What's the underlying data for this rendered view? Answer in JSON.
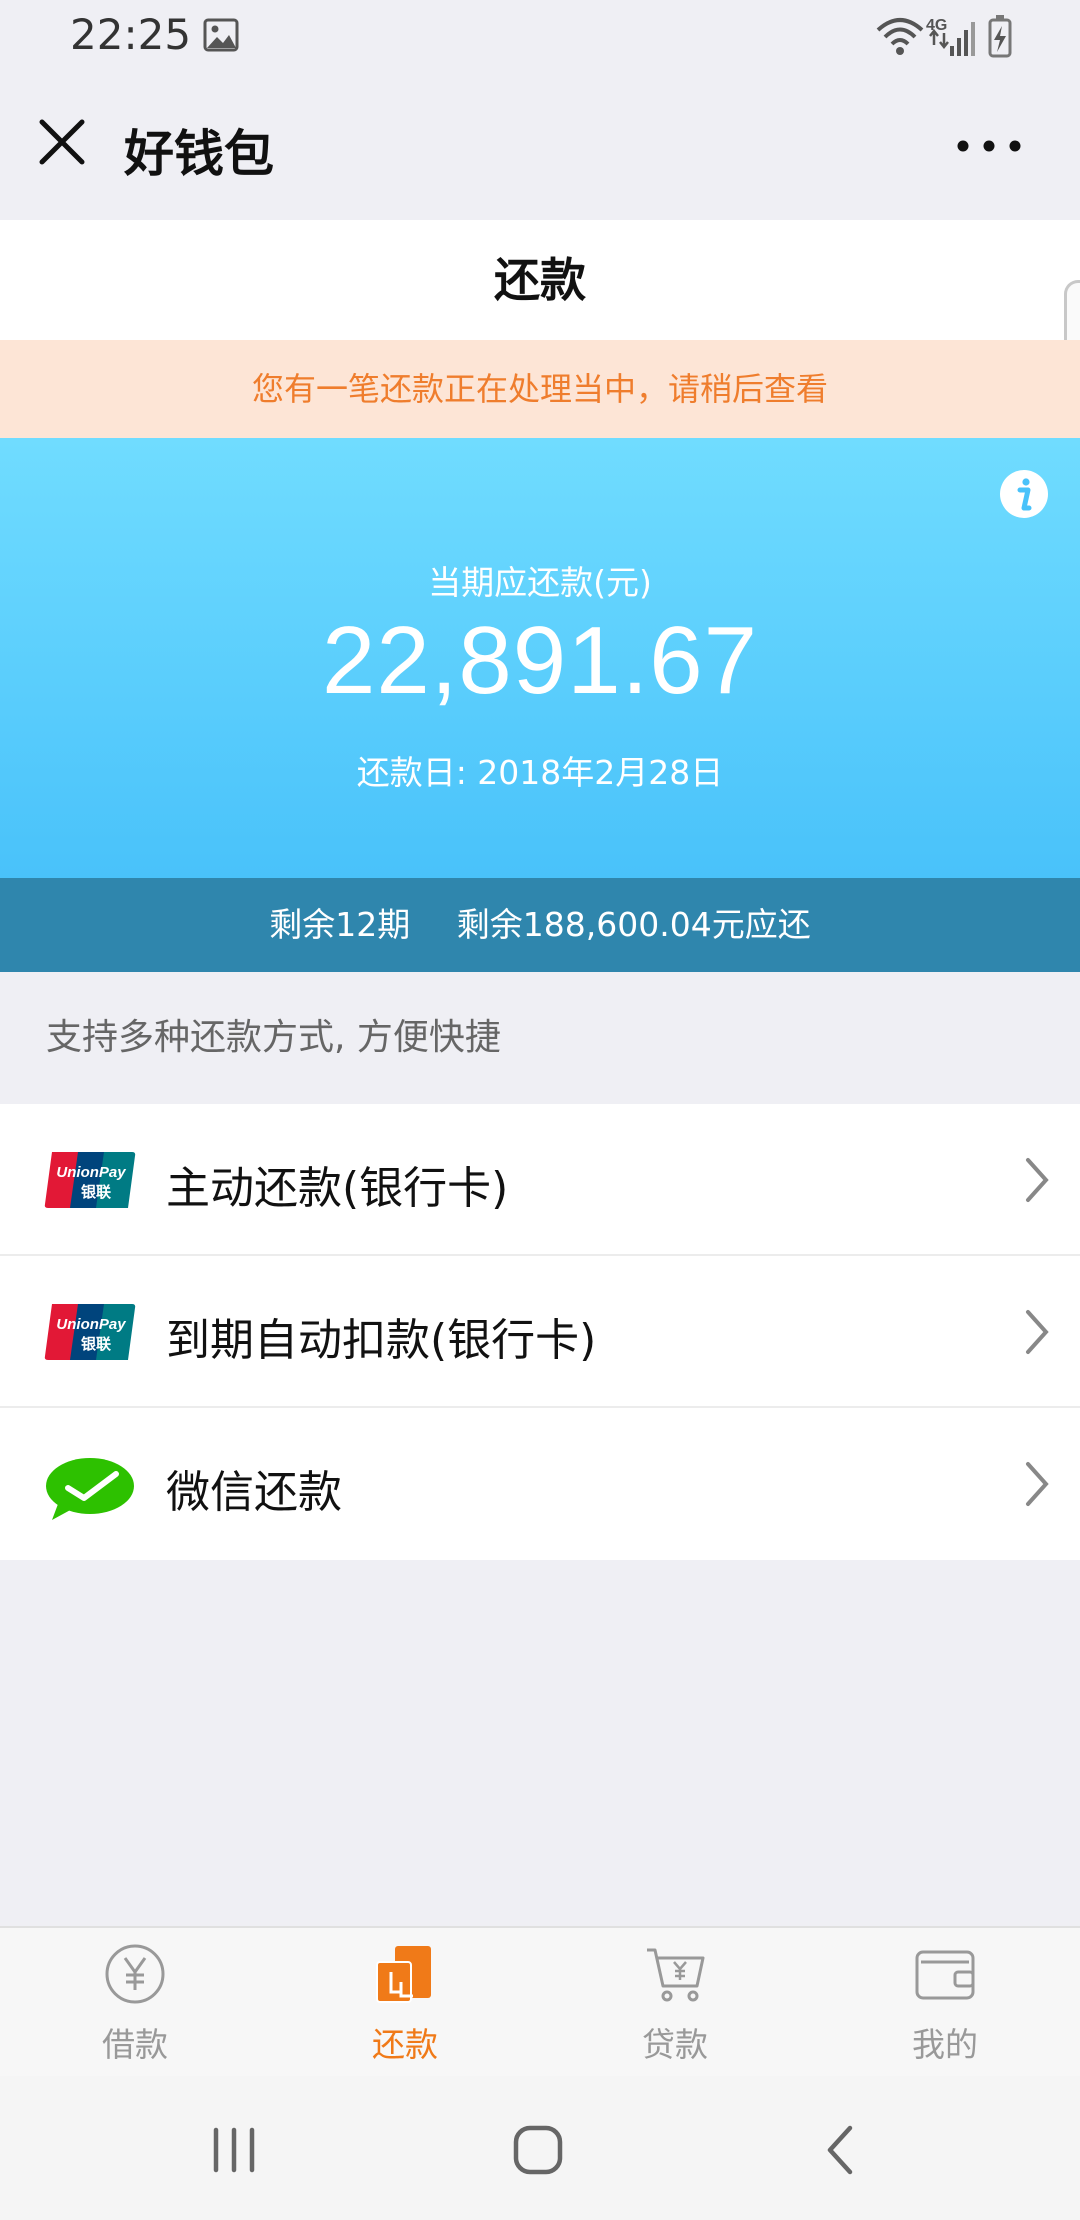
{
  "status_bar": {
    "time": "22:25",
    "icons": [
      "gallery-icon",
      "wifi-icon",
      "signal-4g-icon",
      "battery-charging-icon"
    ]
  },
  "header": {
    "title": "好钱包",
    "close_icon": "close-icon",
    "more_icon": "more-icon"
  },
  "page": {
    "title": "还款"
  },
  "notice": {
    "text": "您有一笔还款正在处理当中，请稍后查看"
  },
  "repayment": {
    "amount_label": "当期应还款(元)",
    "amount": "22,891.67",
    "due_date": "还款日: 2018年2月28日",
    "remaining_periods": "剩余12期",
    "remaining_amount": "剩余188,600.04元应还"
  },
  "methods": {
    "caption": "支持多种还款方式, 方便快捷",
    "items": [
      {
        "label": "主动还款(银行卡)",
        "icon": "unionpay-icon"
      },
      {
        "label": "到期自动扣款(银行卡)",
        "icon": "unionpay-icon"
      },
      {
        "label": "微信还款",
        "icon": "wechat-icon"
      }
    ],
    "unionpay_text": "UnionPay",
    "unionpay_cn": "银联"
  },
  "tabs": [
    {
      "label": "借款",
      "icon": "yen-circle-icon",
      "active": false
    },
    {
      "label": "还款",
      "icon": "repay-icon",
      "active": true
    },
    {
      "label": "贷款",
      "icon": "cart-icon",
      "active": false
    },
    {
      "label": "我的",
      "icon": "wallet-icon",
      "active": false
    }
  ],
  "colors": {
    "accent": "#f07a18",
    "card_top": "#70dcff",
    "card_bottom": "#49c2fa",
    "remaining_bar": "#2f86ad",
    "notice_bg": "#fde5d6",
    "notice_text": "#ef7d2d",
    "wechat_green": "#2dc100"
  }
}
